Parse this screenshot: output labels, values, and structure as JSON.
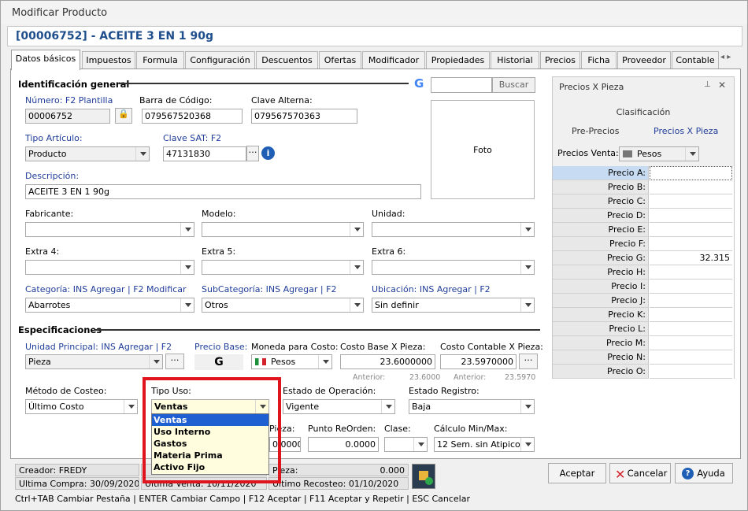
{
  "window": {
    "title": "Modificar Producto",
    "product_title": "[00006752] - ACEITE 3 EN 1 90g"
  },
  "tabs": [
    "Datos básicos",
    "Impuestos",
    "Formula",
    "Configuración",
    "Descuentos",
    "Ofertas",
    "Modificador",
    "Propiedades",
    "Historial",
    "Precios",
    "Ficha",
    "Proveedor",
    "Contable"
  ],
  "ident": {
    "section": "Identificación general",
    "search_placeholder": "",
    "search_btn": "Buscar",
    "numero_label": "Número: F2 Plantilla",
    "numero_value": "00006752",
    "barra_label": "Barra de Código:",
    "barra_value": "079567520368",
    "alterna_label": "Clave Alterna:",
    "alterna_value": "079567570363",
    "tipo_label": "Tipo Artículo:",
    "tipo_value": "Producto",
    "sat_label": "Clave SAT: F2",
    "sat_value": "47131830",
    "desc_label": "Descripción:",
    "desc_value": "ACEITE 3 EN 1 90g",
    "photo_label": "Foto",
    "fabricante_label": "Fabricante:",
    "modelo_label": "Modelo:",
    "unidad_label": "Unidad:",
    "extra4_label": "Extra 4:",
    "extra5_label": "Extra 5:",
    "extra6_label": "Extra 6:",
    "categoria_label": "Categoría:  INS Agregar | F2 Modificar",
    "categoria_value": "Abarrotes",
    "subcat_label": "SubCategoría: INS Agregar | F2",
    "subcat_value": "Otros",
    "ubicacion_label": "Ubicación:  INS Agregar | F2",
    "ubicacion_value": "Sin definir"
  },
  "espec": {
    "section": "Especificaciones",
    "unidad_label": "Unidad Principal: INS Agregar | F2",
    "unidad_value": "Pieza",
    "precio_base_label": "Precio Base:",
    "precio_base_value": "G",
    "moneda_label": "Moneda para Costo:",
    "moneda_value": "Pesos",
    "costo_label": "Costo Base X Pieza:",
    "costo_value": "23.6000000",
    "contable_label": "Costo Contable X Pieza:",
    "contable_value": "23.5970000",
    "anterior_label": "Anterior:",
    "anterior1": "23.6000",
    "anterior2": "23.5970",
    "metodo_label": "Método de Costeo:",
    "metodo_value": "Último Costo",
    "tipo_uso_label": "Tipo Uso:",
    "tipo_uso_value": "Ventas",
    "estado_op_label": "Estado de Operación:",
    "estado_op_value": "Vigente",
    "estado_reg_label": "Estado Registro:",
    "estado_reg_value": "Baja",
    "pieza_label": "Pieza:",
    "reorden_label": "Punto ReOrden:",
    "reorden_value": "0.0000",
    "clase_label": "Clase:",
    "calculo_label": "Cálculo Min/Max:",
    "calculo_value": "12 Sem. sin Atipicos",
    "hidden_min_value": "0.0000"
  },
  "dropdown": [
    "Ventas",
    "Uso Interno",
    "Gastos",
    "Materia Prima",
    "Activo Fijo"
  ],
  "side": {
    "title": "Precios X Pieza",
    "clasificacion": "Clasificación",
    "tab1": "Pre-Precios",
    "tab2": "Precios X Pieza",
    "ventas_label": "Precios Venta:",
    "ventas_value": "Pesos",
    "rows": [
      {
        "l": "Precio A:",
        "v": ""
      },
      {
        "l": "Precio B:",
        "v": ""
      },
      {
        "l": "Precio C:",
        "v": ""
      },
      {
        "l": "Precio D:",
        "v": ""
      },
      {
        "l": "Precio E:",
        "v": ""
      },
      {
        "l": "Precio F:",
        "v": ""
      },
      {
        "l": "Precio G:",
        "v": "32.315"
      },
      {
        "l": "Precio H:",
        "v": ""
      },
      {
        "l": "Precio I:",
        "v": ""
      },
      {
        "l": "Precio J:",
        "v": ""
      },
      {
        "l": "Precio K:",
        "v": ""
      },
      {
        "l": "Precio L:",
        "v": ""
      },
      {
        "l": "Precio M:",
        "v": ""
      },
      {
        "l": "Precio N:",
        "v": ""
      },
      {
        "l": "Precio O:",
        "v": ""
      }
    ]
  },
  "status": {
    "creador": "Creador: FREDY",
    "ultima_compra": "Ultima Compra: 30/09/2020",
    "ultima_venta": "Ultima Venta: 10/11/2020",
    "pieza": "Pieza:",
    "pieza_value": "0.000",
    "recosteo": "Ultimo Recosteo: 01/10/2020",
    "help": "Ctrl+TAB Cambiar Pestaña | ENTER Cambiar Campo | F12 Aceptar | F11 Aceptar y Repetir | ESC Cancelar"
  },
  "buttons": {
    "aceptar": "Aceptar",
    "cancelar": "Cancelar",
    "ayuda": "Ayuda"
  }
}
